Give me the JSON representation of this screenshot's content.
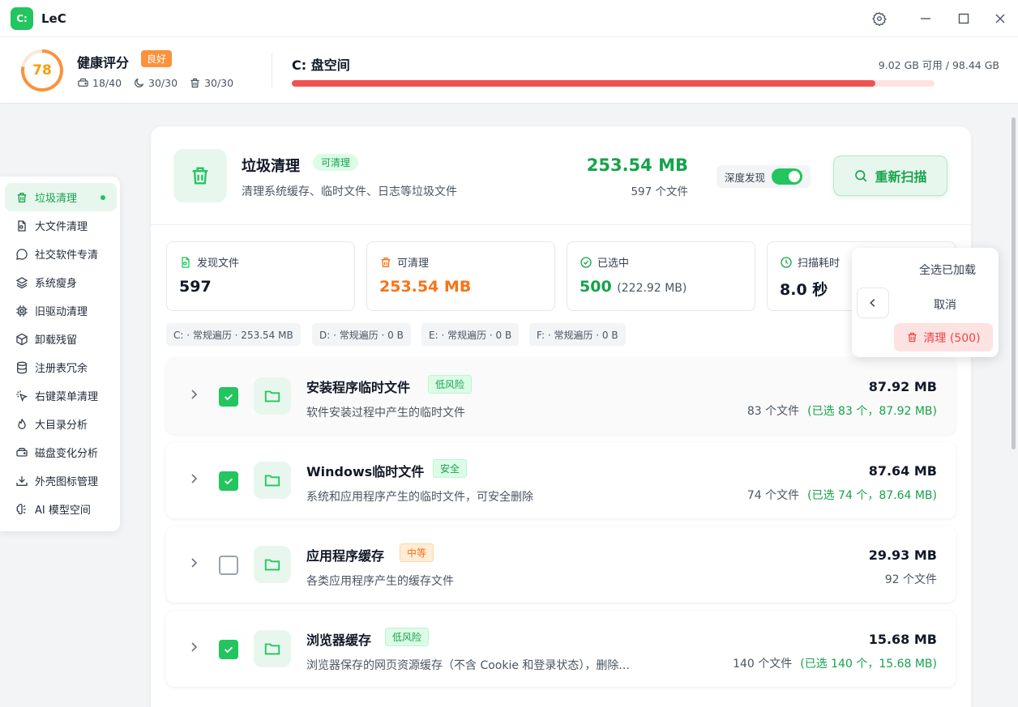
{
  "app": {
    "logo_text": "C:",
    "title": "LeC"
  },
  "health": {
    "score": "78",
    "title": "健康评分",
    "badge": "良好",
    "stats": [
      "18/40",
      "30/30",
      "30/30"
    ]
  },
  "disk": {
    "title": "C: 盘空间",
    "usage": "9.02 GB 可用 / 98.44 GB",
    "used_fraction": 0.908
  },
  "sidebar": {
    "items": [
      {
        "label": "垃圾清理",
        "icon": "trash-icon"
      },
      {
        "label": "大文件清理",
        "icon": "file-search-icon"
      },
      {
        "label": "社交软件专清",
        "icon": "chat-icon"
      },
      {
        "label": "系统瘦身",
        "icon": "layers-icon"
      },
      {
        "label": "旧驱动清理",
        "icon": "chip-icon"
      },
      {
        "label": "卸载残留",
        "icon": "package-icon"
      },
      {
        "label": "注册表冗余",
        "icon": "database-icon"
      },
      {
        "label": "右键菜单清理",
        "icon": "pointer-icon"
      },
      {
        "label": "大目录分析",
        "icon": "flame-icon"
      },
      {
        "label": "磁盘变化分析",
        "icon": "hard-drive-icon"
      },
      {
        "label": "外壳图标管理",
        "icon": "download-tray-icon"
      },
      {
        "label": "AI 模型空间",
        "icon": "brain-icon"
      }
    ]
  },
  "main": {
    "title": "垃圾清理",
    "badge": "可清理",
    "desc": "清理系统缓存、临时文件、日志等垃圾文件",
    "size": "253.54 MB",
    "count": "597 个文件",
    "deep_label": "深度发现",
    "rescan": "重新扫描",
    "stats": [
      {
        "label": "发现文件",
        "value": "597",
        "sub": ""
      },
      {
        "label": "可清理",
        "value": "253.54 MB",
        "sub": ""
      },
      {
        "label": "已选中",
        "value": "500",
        "sub": "(222.92 MB)"
      },
      {
        "label": "扫描耗时",
        "value": "8.0 秒",
        "sub": ""
      }
    ],
    "drives": [
      "C: · 常规遍历 · 253.54 MB",
      "D: · 常规遍历 · 0 B",
      "E: · 常规遍历 · 0 B",
      "F: · 常规遍历 · 0 B"
    ],
    "rows": [
      {
        "title": "安装程序临时文件",
        "badge": "低风险",
        "desc": "软件安装过程中产生的临时文件",
        "size": "87.92 MB",
        "count": "83 个文件",
        "selected": "(已选 83 个，87.92 MB)"
      },
      {
        "title": "Windows临时文件",
        "badge": "安全",
        "desc": "系统和应用程序产生的临时文件，可安全删除",
        "size": "87.64 MB",
        "count": "74 个文件",
        "selected": "(已选 74 个，87.64 MB)"
      },
      {
        "title": "应用程序缓存",
        "badge": "中等",
        "desc": "各类应用程序产生的缓存文件",
        "size": "29.93 MB",
        "count": "92 个文件",
        "selected": ""
      },
      {
        "title": "浏览器缓存",
        "badge": "低风险",
        "desc": "浏览器保存的网页资源缓存（不含 Cookie 和登录状态），删除...",
        "size": "15.68 MB",
        "count": "140 个文件",
        "selected": "(已选 140 个，15.68 MB)"
      }
    ]
  },
  "popup": {
    "select_all": "全选已加载",
    "cancel": "取消",
    "clean": "清理 (500)"
  },
  "colors": {
    "accent": "#22c55e",
    "orange": "#f97316",
    "danger": "#ef4444"
  }
}
